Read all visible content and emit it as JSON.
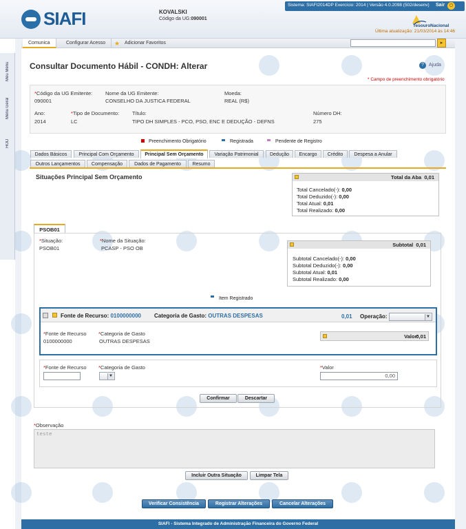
{
  "header": {
    "logo": "SIAFI",
    "user_name": "KOVALSKI",
    "ug_code_label": "Código da UG:",
    "ug_code": "090001",
    "system_info": "Sistema: SIAFI2014DP Exercício: 2014 | Versão 4.0.2098 (502/desenv)",
    "logout_label": "Sair",
    "tesouro_label": "TesouroNacional",
    "last_update": "Última atualização: 21/03/2014 às 14:46"
  },
  "sidebar": {
    "items": [
      "Meu Menu",
      "Menu Geral",
      "HOD"
    ]
  },
  "menu": {
    "items": [
      "Comunica",
      "Configurar Acesso",
      "Adicionar Favoritos"
    ]
  },
  "page": {
    "title": "Consultar Documento Hábil - CONDH: Alterar",
    "help": "Ajuda",
    "required_note": "* Campo de preenchimento obrigatório"
  },
  "info": {
    "ug_emitente_label": "Código da UG Emitente:",
    "ug_emitente": "090001",
    "nome_ug_label": "Nome da UG Emitente:",
    "nome_ug": "CONSELHO DA JUSTICA FEDERAL",
    "moeda_label": "Moeda:",
    "moeda": "REAL (R$)",
    "ano_label": "Ano:",
    "ano": "2014",
    "tipo_doc_label": "Tipo de Documento:",
    "tipo_doc": "LC",
    "titulo_label": "Título:",
    "titulo": "TIPO DH SIMPLES - PCO, PSO, ENC E DEDUÇÃO - DEFNS",
    "numero_dh_label": "Número DH:",
    "numero_dh": "275"
  },
  "legend": {
    "obrigatorio": "Preenchimento Obrigatório",
    "registrada": "Registrada",
    "pendente": "Pendente de Registro",
    "colors": {
      "obrigatorio": "#cc0000",
      "registrada": "#2d6ea4",
      "pendente": "#c080c0"
    }
  },
  "tabs": {
    "row1": [
      "Dados Básicos",
      "Principal Com Orçamento",
      "Principal Sem Orçamento",
      "Variação Patrimonial",
      "Dedução",
      "Encargo",
      "Crédito",
      "Despesa a Anular"
    ],
    "row2": [
      "Outros Lançamentos",
      "Compensação",
      "Dados de Pagamento",
      "Resumo"
    ],
    "active": "Principal Sem Orçamento"
  },
  "section": {
    "title": "Situações Principal Sem Orçamento"
  },
  "total_aba": {
    "title": "Total da Aba",
    "value": "0,01",
    "lines": [
      {
        "label": "Total Cancelado(-):",
        "value": "0,00"
      },
      {
        "label": "Total Deduzido(-):",
        "value": "0,00"
      },
      {
        "label": "Total Atual:",
        "value": "0,01"
      },
      {
        "label": "Total Realizado:",
        "value": "0,00"
      }
    ]
  },
  "situacao": {
    "tab_label": "PSOB01",
    "situacao_label": "Situação:",
    "situacao": "PSOB01",
    "nome_label": "Nome da Situação:",
    "nome": "PCASP - PSO OB",
    "item_registrado": "Item Registrado"
  },
  "subtotal": {
    "title": "Subtotal",
    "value": "0,01",
    "lines": [
      {
        "label": "Subtotal Cancelado(-):",
        "value": "0,00"
      },
      {
        "label": "Subtotal Deduzido(-):",
        "value": "0,00"
      },
      {
        "label": "Subtotal Atual:",
        "value": "0,01"
      },
      {
        "label": "Subtotal Realizado:",
        "value": "0,00"
      }
    ]
  },
  "item": {
    "fonte_label": "Fonte de Recurso:",
    "fonte": "0100000000",
    "categoria_label": "Categoria de Gasto:",
    "categoria": "OUTRAS DESPESAS",
    "valor": "0,01",
    "operacao_label": "Operação:",
    "detail_fonte_label": "Fonte de Recurso",
    "detail_fonte": "0100000000",
    "detail_categoria_label": "Categoria de Gasto",
    "detail_categoria": "OUTRAS DESPESAS",
    "valor_label": "Valor:",
    "valor_box": "0,01"
  },
  "new_item": {
    "fonte_label": "Fonte de Recurso",
    "categoria_label": "Categoria de Gasto",
    "valor_label": "Valor",
    "valor_value": "0,00",
    "confirm": "Confirmar",
    "discard": "Descartar"
  },
  "observacao": {
    "label": "Observação",
    "value": "teste"
  },
  "actions": {
    "incluir": "Incluir Outra Situação",
    "limpar": "Limpar Tela",
    "verificar": "Verificar Consistência",
    "registrar": "Registrar Alterações",
    "cancelar": "Cancelar Alterações"
  },
  "footer": {
    "text": "SIAFI - Sistema Integrado de Administração Financeira do Governo Federal"
  }
}
